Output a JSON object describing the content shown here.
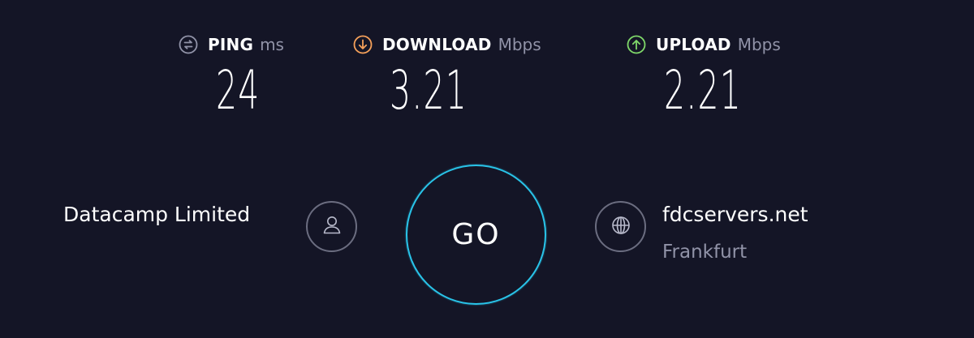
{
  "metrics": {
    "ping": {
      "label": "PING",
      "unit": "ms",
      "value": "24",
      "icon": "ping-icon",
      "color": "#9193a8"
    },
    "download": {
      "label": "DOWNLOAD",
      "unit": "Mbps",
      "value": "3.21",
      "icon": "download-arrow-icon",
      "color": "#f5a05a"
    },
    "upload": {
      "label": "UPLOAD",
      "unit": "Mbps",
      "value": "2.21",
      "icon": "upload-arrow-icon",
      "color": "#7fd86a"
    }
  },
  "provider": {
    "name": "Datacamp Limited",
    "icon": "user-icon"
  },
  "go_button": {
    "label": "GO",
    "ring_color": "#29c3e8"
  },
  "server": {
    "host": "fdcservers.net",
    "location": "Frankfurt",
    "icon": "globe-icon"
  },
  "colors": {
    "background": "#141526",
    "muted_text": "#9193a8",
    "icon_ring": "#6b6d80"
  }
}
